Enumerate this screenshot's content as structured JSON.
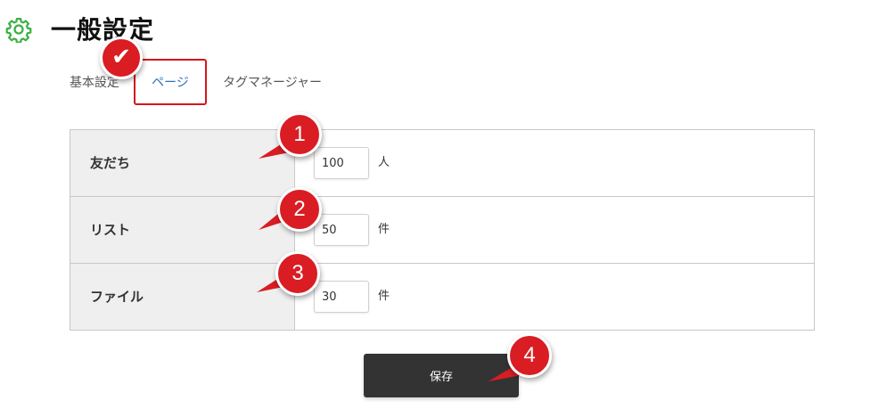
{
  "header": {
    "title": "一般設定",
    "icon": "gear-icon",
    "icon_color": "#3cb043"
  },
  "tabs": [
    {
      "label": "基本設定",
      "active": false
    },
    {
      "label": "ページ",
      "active": true
    },
    {
      "label": "タグマネージャー",
      "active": false
    }
  ],
  "annotations": {
    "check": "✔",
    "markers": [
      "1",
      "2",
      "3",
      "4"
    ],
    "color": "#d91d23"
  },
  "settings": {
    "rows": [
      {
        "label": "友だち",
        "value": "100",
        "unit": "人"
      },
      {
        "label": "リスト",
        "value": "50",
        "unit": "件"
      },
      {
        "label": "ファイル",
        "value": "30",
        "unit": "件"
      }
    ]
  },
  "actions": {
    "save_label": "保存"
  }
}
